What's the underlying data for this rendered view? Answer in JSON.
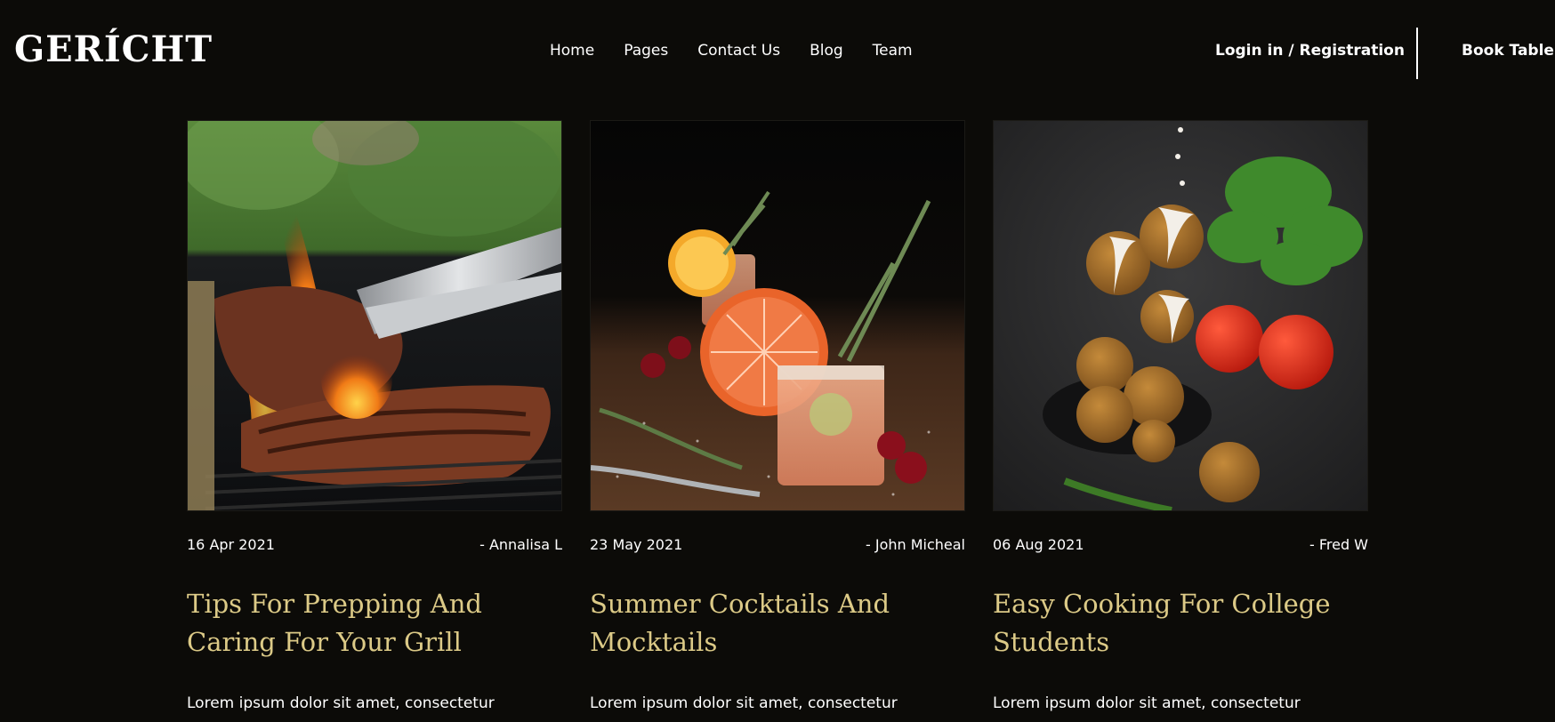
{
  "brand": {
    "logo_text": "GERÍCHT"
  },
  "nav": {
    "links": [
      {
        "label": "Home"
      },
      {
        "label": "Pages"
      },
      {
        "label": "Contact Us"
      },
      {
        "label": "Blog"
      },
      {
        "label": "Team"
      }
    ],
    "login_label": "Login in / Registration",
    "book_label": "Book Table"
  },
  "posts": [
    {
      "date": "16 Apr 2021",
      "author": "- Annalisa L",
      "title": "Tips For Prepping And Caring For Your Grill",
      "excerpt": "Lorem ipsum dolor sit amet, consectetur",
      "image": "grilled-steak-image"
    },
    {
      "date": "23 May 2021",
      "author": "- John Micheal",
      "title": "Summer Cocktails And Mocktails",
      "excerpt": "Lorem ipsum dolor sit amet, consectetur",
      "image": "cocktail-image"
    },
    {
      "date": "06 Aug 2021",
      "author": "- Fred W",
      "title": "Easy Cooking For College Students",
      "excerpt": "Lorem ipsum dolor sit amet, consectetur",
      "image": "falafel-image"
    }
  ],
  "colors": {
    "background": "#0c0b08",
    "accent_gold": "#dcca87",
    "text": "#ffffff"
  }
}
